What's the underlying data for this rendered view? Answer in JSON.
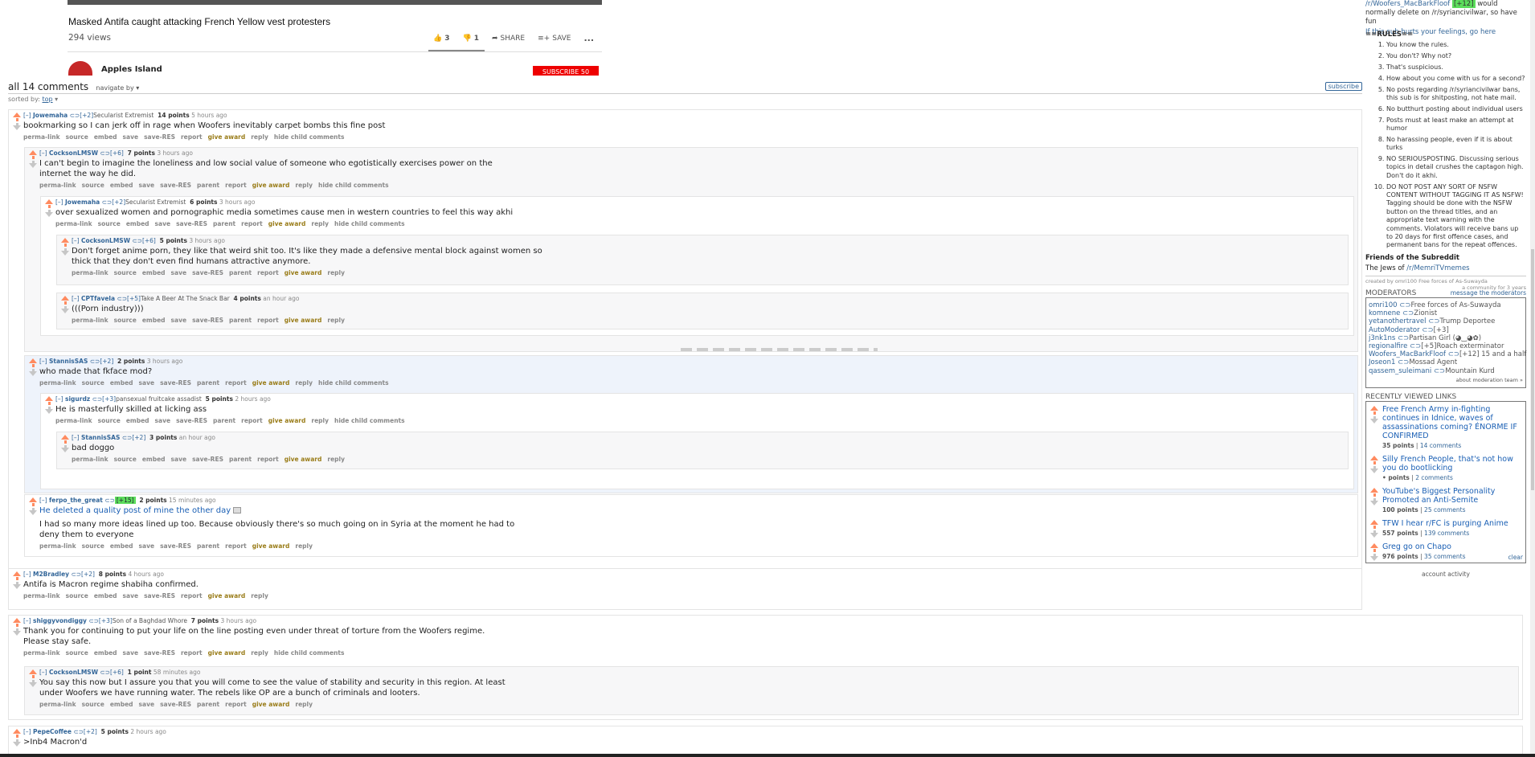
{
  "video": {
    "title": "Masked Antifa caught attacking French Yellow vest protesters",
    "views": "294 views",
    "likes": "3",
    "dislikes": "1",
    "share": "SHARE",
    "save": "SAVE",
    "more": "...",
    "channel": "Apples Island",
    "subscribe": "SUBSCRIBE 50"
  },
  "comments_header": {
    "count": "all 14 comments",
    "navigate": "navigate by ▾",
    "subscribe": "subscribe",
    "sorted_label": "sorted by:",
    "sorted_value": "top"
  },
  "comments": [
    {
      "expand": "[–]",
      "author": "Jowemaha",
      "flair": "[+2]",
      "flairtext": "Secularist Extremist",
      "points": "14 points",
      "time": "5 hours ago",
      "lines": [
        "bookmarking so I can jerk off in rage when Woofers inevitably carpet bombs this fine post"
      ],
      "buttons": [
        "perma-link",
        "source",
        "embed",
        "save",
        "save-RES",
        "report",
        "give award",
        "reply",
        "hide child comments"
      ]
    },
    {
      "expand": "[–]",
      "author": "CocksonLMSW",
      "flair": "[+6]",
      "flairtext": "",
      "points": "7 points",
      "time": "3 hours ago",
      "lines": [
        "I can't begin to imagine the loneliness and low social value of someone who egotistically exercises power on the",
        "internet the way he did."
      ],
      "buttons": [
        "perma-link",
        "source",
        "embed",
        "save",
        "save-RES",
        "parent",
        "report",
        "give award",
        "reply",
        "hide child comments"
      ]
    },
    {
      "expand": "[–]",
      "author": "Jowemaha",
      "flair": "[+2]",
      "flairtext": "Secularist Extremist",
      "points": "6 points",
      "time": "3 hours ago",
      "lines": [
        "over sexualized women and pornographic media sometimes cause men in western countries to feel this way akhi"
      ],
      "buttons": [
        "perma-link",
        "source",
        "embed",
        "save",
        "save-RES",
        "parent",
        "report",
        "give award",
        "reply",
        "hide child comments"
      ]
    },
    {
      "expand": "[–]",
      "author": "CocksonLMSW",
      "flair": "[+6]",
      "flairtext": "",
      "points": "5 points",
      "time": "3 hours ago",
      "lines": [
        "Don't forget anime porn, they like that weird shit too. It's like they made a defensive mental block against women so",
        "thick that they don't even find humans attractive anymore."
      ],
      "buttons": [
        "perma-link",
        "source",
        "embed",
        "save",
        "save-RES",
        "parent",
        "report",
        "give award",
        "reply"
      ]
    },
    {
      "expand": "[–]",
      "author": "CPTfavela",
      "flair": "[+5]",
      "flairtext": "Take A Beer At The Snack Bar",
      "points": "4 points",
      "time": "an hour ago",
      "lines": [
        "(((Porn industry)))"
      ],
      "buttons": [
        "perma-link",
        "source",
        "embed",
        "save",
        "save-RES",
        "parent",
        "report",
        "give award",
        "reply"
      ]
    },
    {
      "expand": "[–]",
      "author": "StannisSAS",
      "flair": "[+2]",
      "flairtext": "",
      "points": "2 points",
      "time": "3 hours ago",
      "lines": [
        "who made that fkface mod?"
      ],
      "buttons": [
        "perma-link",
        "source",
        "embed",
        "save",
        "save-RES",
        "parent",
        "report",
        "give award",
        "reply",
        "hide child comments"
      ]
    },
    {
      "expand": "[–]",
      "author": "sigurdz",
      "flair": "[+3]",
      "flairtext": "pansexual fruitcake assadist",
      "points": "5 points",
      "time": "2 hours ago",
      "lines": [
        "He is masterfully skilled at licking ass"
      ],
      "buttons": [
        "perma-link",
        "source",
        "embed",
        "save",
        "save-RES",
        "parent",
        "report",
        "give award",
        "reply",
        "hide child comments"
      ]
    },
    {
      "expand": "[–]",
      "author": "StannisSAS",
      "flair": "[+2]",
      "flairtext": "",
      "points": "3 points",
      "time": "an hour ago",
      "lines": [
        "bad doggo"
      ],
      "buttons": [
        "perma-link",
        "source",
        "embed",
        "save",
        "save-RES",
        "parent",
        "report",
        "give award",
        "reply"
      ]
    },
    {
      "expand": "[–]",
      "author": "ferpo_the_great",
      "flair": "[+15]",
      "flairtext": "",
      "points": "2 points",
      "time": "15 minutes ago",
      "link": "He deleted a quality post of mine the other day",
      "lines": [
        "I had so many more ideas lined up too. Because obviously there's so much going on in Syria at the moment he had to",
        "deny them to everyone"
      ],
      "buttons": [
        "perma-link",
        "source",
        "embed",
        "save",
        "save-RES",
        "parent",
        "report",
        "give award",
        "reply"
      ]
    },
    {
      "expand": "[–]",
      "author": "M2Bradley",
      "flair": "[+2]",
      "flairtext": "",
      "points": "8 points",
      "time": "4 hours ago",
      "lines": [
        "Antifa is Macron regime shabiha confirmed."
      ],
      "buttons": [
        "perma-link",
        "source",
        "embed",
        "save",
        "save-RES",
        "report",
        "give award",
        "reply"
      ]
    },
    {
      "expand": "[–]",
      "author": "shiggyvondiggy",
      "flair": "[+3]",
      "flairtext": "Son of a Baghdad Whore",
      "points": "7 points",
      "time": "3 hours ago",
      "lines": [
        "Thank you for continuing to put your life on the line posting even under threat of torture from the Woofers regime.",
        "Please stay safe."
      ],
      "buttons": [
        "perma-link",
        "source",
        "embed",
        "save",
        "save-RES",
        "report",
        "give award",
        "reply",
        "hide child comments"
      ]
    },
    {
      "expand": "[–]",
      "author": "CocksonLMSW",
      "flair": "[+6]",
      "flairtext": "",
      "points": "1 point",
      "time": "58 minutes ago",
      "lines": [
        "You say this now but I assure you that you will come to see the value of stability and security in this region. At least",
        "under Woofers we have running water. The rebels like OP are a bunch of criminals and looters."
      ],
      "buttons": [
        "perma-link",
        "source",
        "embed",
        "save",
        "save-RES",
        "parent",
        "report",
        "give award",
        "reply"
      ]
    },
    {
      "expand": "[–]",
      "author": "PepeCoffee",
      "flair": "[+2]",
      "flairtext": "",
      "points": "5 points",
      "time": "2 hours ago",
      "lines": [
        ">Inb4 Macron'd"
      ],
      "buttons": []
    }
  ],
  "sidebar": {
    "top_line1": "/r/Woofers_MacBarkFloof",
    "top_line1b": "would",
    "top_line2": "normally delete on /r/syriancivilwar, so have fun",
    "top_link": "If this sub hurts your feelings, go here",
    "rules_heading": "==RULES==",
    "rules": [
      "You know the rules.",
      "You don't? Why not?",
      "That's suspicious.",
      "How about you come with us for a second?",
      "No posts regarding /r/syriancivilwar bans, this sub is for shitposting, not hate mail.",
      "No butthurt posting about individual users",
      "Posts must at least make an attempt at humor",
      "No harassing people, even if it is about turks",
      "NO SERIOUSPOSTING. Discussing serious topics in detail crushes the captagon high. Don't do it akhi.",
      "DO NOT POST ANY SORT OF NSFW CONTENT WITHOUT TAGGING IT AS NSFW! Tagging should be done with the NSFW button on the thread titles, and an appropriate text warning with the comments. Violators will receive bans up to 20 days for first offence cases, and permanent bans for the repeat offences."
    ],
    "friends_heading": "Friends of the Subreddit",
    "friends_text": "The Jews of",
    "friends_link": "/r/MemriTVmemes",
    "created_by": "created by omri100  Free forces of As-Suwayda",
    "community": "a community for 3 years",
    "moderators_heading": "MODERATORS",
    "message_mods": "message the moderators",
    "mods": [
      {
        "name": "omri100",
        "flair": "Free forces of As-Suwayda"
      },
      {
        "name": "komnene",
        "flair": "Zionist"
      },
      {
        "name": "yetanothertravel",
        "flair": "Trump Deportee"
      },
      {
        "name": "AutoModerator",
        "flair": "[+3]"
      },
      {
        "name": "j3nk1ns",
        "flair": "Partisan Girl (◕‿◕✿)"
      },
      {
        "name": "regionalfire",
        "flair": "[+5]Roach exterminator"
      },
      {
        "name": "Woofers_MacBarkFloof",
        "flair": "[+12] 15 and a half"
      },
      {
        "name": "Joseon1",
        "flair": "Mossad Agent"
      },
      {
        "name": "qassem_suleimani",
        "flair": "Mountain Kurd"
      }
    ],
    "about_mod_team": "about moderation team »",
    "recently_viewed_heading": "RECENTLY VIEWED LINKS",
    "recently_viewed": [
      {
        "title": "Free French Army in-fighting continues in Idnice, waves of assassinations coming? ÉNORME IF CONFIRMED",
        "points": "35 points",
        "comments": "14 comments"
      },
      {
        "title": "Silly French People, that's not how you do bootlicking",
        "points": "• points",
        "comments": "2 comments"
      },
      {
        "title": "YouTube's Biggest Personality Promoted an Anti-Semite",
        "points": "100 points",
        "comments": "25 comments"
      },
      {
        "title": "TFW I hear r/FC is purging Anime",
        "points": "557 points",
        "comments": "139 comments"
      },
      {
        "title": "Greg go on Chapo",
        "points": "976 points",
        "comments": "35 comments"
      }
    ],
    "clear": "clear",
    "account_activity": "account activity"
  }
}
